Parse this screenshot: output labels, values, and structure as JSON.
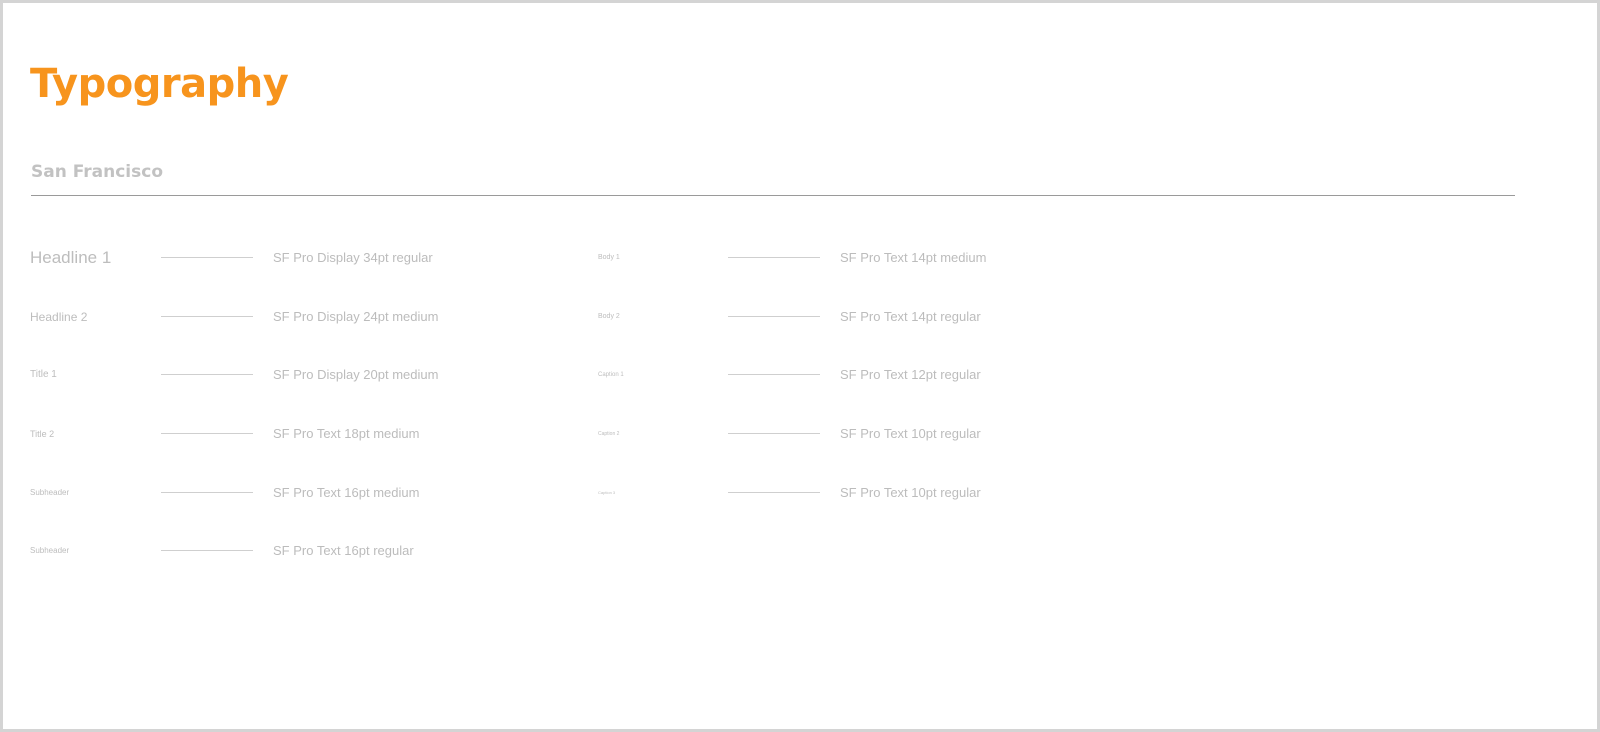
{
  "page": {
    "title": "Typography",
    "accent_color": "#f7941d",
    "section_title": "San Francisco"
  },
  "styles_left": [
    {
      "name": "Headline 1",
      "spec": "SF Pro Display 34pt regular"
    },
    {
      "name": "Headline 2",
      "spec": "SF Pro Display 24pt medium"
    },
    {
      "name": "Title 1",
      "spec": "SF Pro Display 20pt medium"
    },
    {
      "name": "Title 2",
      "spec": "SF Pro Text 18pt medium"
    },
    {
      "name": "Subheader",
      "spec": "SF Pro Text 16pt medium"
    },
    {
      "name": "Subheader",
      "spec": "SF Pro Text 16pt regular"
    }
  ],
  "styles_right": [
    {
      "name": "Body 1",
      "spec": "SF Pro Text 14pt medium"
    },
    {
      "name": "Body 2",
      "spec": "SF Pro Text 14pt regular"
    },
    {
      "name": "Caption 1",
      "spec": "SF Pro Text 12pt regular"
    },
    {
      "name": "Caption 2",
      "spec": "SF Pro Text 10pt regular"
    },
    {
      "name": "Caption 3",
      "spec": "SF Pro Text 10pt regular"
    }
  ]
}
